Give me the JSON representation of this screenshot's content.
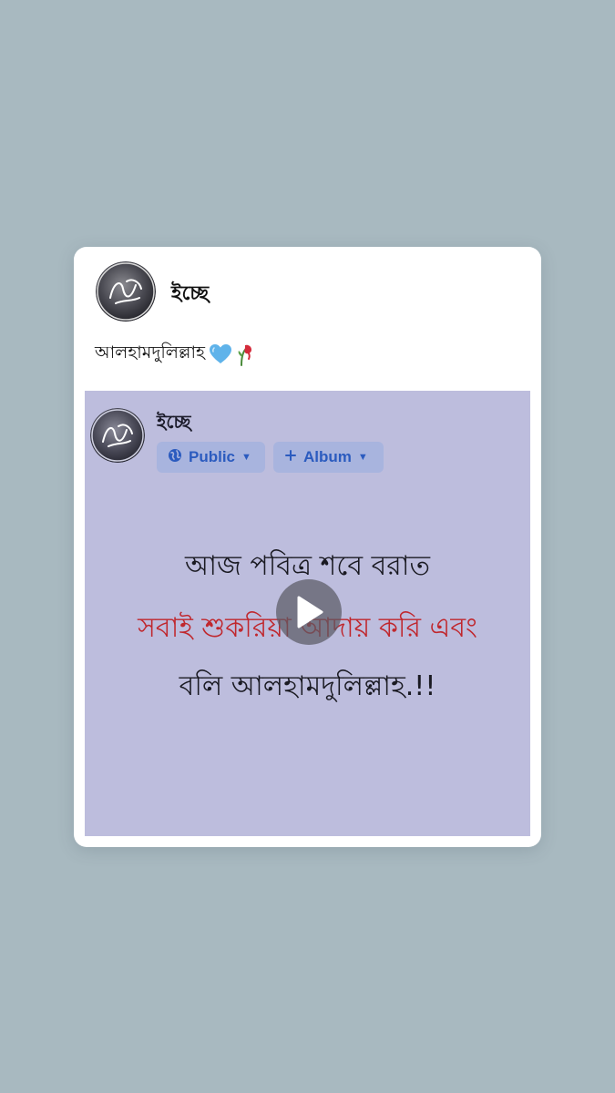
{
  "post": {
    "author": "ইচ্ছে",
    "caption": "আলহামদুলিল্লাহ",
    "caption_emojis": [
      "blue-heart-icon",
      "wilted-rose-icon"
    ]
  },
  "media": {
    "inner_author": "ইচ্ছে",
    "privacy_label": "Public",
    "album_label": "Album",
    "line1": "আজ পবিত্র শবে বরাত",
    "line2": "সবাই শুকরিয়া আদায় করি এবং",
    "line3": "বলি আলহামদুলিল্লাহ.!!",
    "play_icon": "play-icon"
  },
  "colors": {
    "background": "#a8b9c0",
    "media_background": "#bdbddd",
    "highlight_text": "#c0272d",
    "chip_text": "#2b5bbf"
  }
}
